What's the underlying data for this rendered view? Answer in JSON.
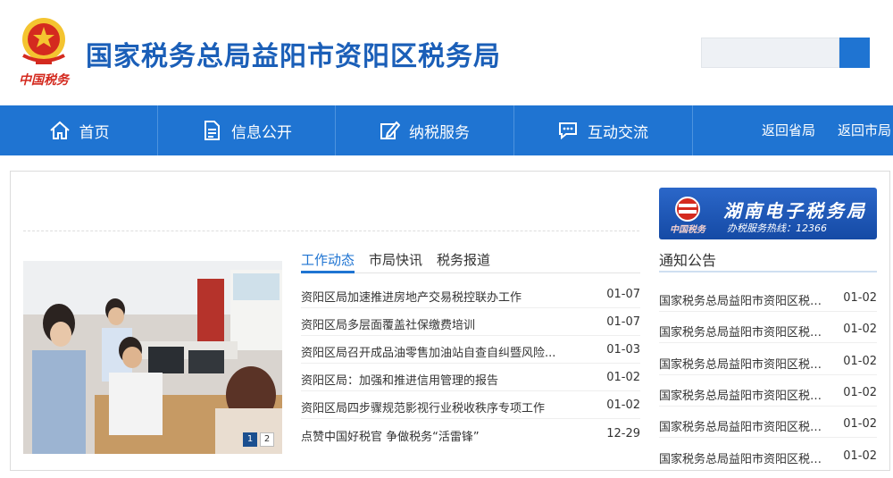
{
  "header": {
    "emblem_caption": "中国税务",
    "title": "国家税务总局益阳市资阳区税务局",
    "search": {
      "value": ""
    },
    "colors": {
      "title": "#1b5fb8",
      "accent": "#1f74d2"
    }
  },
  "nav": {
    "items": [
      {
        "label": "首页",
        "icon": "home-icon"
      },
      {
        "label": "信息公开",
        "icon": "document-icon"
      },
      {
        "label": "纳税服务",
        "icon": "edit-icon"
      },
      {
        "label": "互动交流",
        "icon": "chat-icon"
      }
    ],
    "links": [
      "返回省局",
      "返回市局"
    ]
  },
  "slider": {
    "pages": [
      "1",
      "2"
    ],
    "active_page": "1"
  },
  "news": {
    "tabs": [
      "工作动态",
      "市局快讯",
      "税务报道"
    ],
    "active_tab": "工作动态",
    "items": [
      {
        "title": "资阳区局加速推进房地产交易税控联办工作",
        "date": "01-07"
      },
      {
        "title": "资阳区局多层面覆盖社保缴费培训",
        "date": "01-07"
      },
      {
        "title": "资阳区局召开成品油零售加油站自查自纠暨风险...",
        "date": "01-03"
      },
      {
        "title": "资阳区局：加强和推进信用管理的报告",
        "date": "01-02"
      },
      {
        "title": "资阳区局四步骤规范影视行业税收秩序专项工作",
        "date": "01-02"
      },
      {
        "title": "点赞中国好税官 争做税务“活雷锋”",
        "date": "12-29"
      }
    ]
  },
  "banner": {
    "title": "湖南电子税务局",
    "subtitle": "办税服务热线：12366",
    "logo_caption": "中国税务"
  },
  "notice": {
    "title": "通知公告",
    "items": [
      {
        "title": "国家税务总局益阳市资阳区税务...",
        "date": "01-02"
      },
      {
        "title": "国家税务总局益阳市资阳区税务...",
        "date": "01-02"
      },
      {
        "title": "国家税务总局益阳市资阳区税务...",
        "date": "01-02"
      },
      {
        "title": "国家税务总局益阳市资阳区税务...",
        "date": "01-02"
      },
      {
        "title": "国家税务总局益阳市资阳区税务...",
        "date": "01-02"
      },
      {
        "title": "国家税务总局益阳市资阳区税务...",
        "date": "01-02"
      }
    ]
  }
}
